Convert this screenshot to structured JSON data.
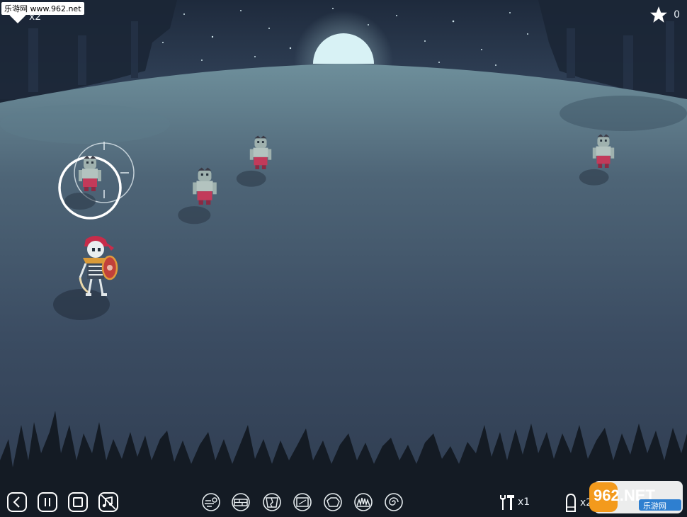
{
  "watermark_top": "乐游网 www.962.net",
  "hud": {
    "lives_label": "x2",
    "stars_label": "0"
  },
  "controls": {
    "icons": [
      "back-icon",
      "pause-icon",
      "stop-icon",
      "music-off-icon"
    ]
  },
  "abilities": {
    "icons": [
      "wind-icon",
      "barrier-icon",
      "crack-icon",
      "box-icon",
      "rock-icon",
      "spikes-icon",
      "vortex-icon"
    ]
  },
  "counters": {
    "tools_label": "x1",
    "ammo_label": "x2"
  },
  "logo": {
    "brand_text": "962.NET",
    "sub_text": "乐游网"
  },
  "colors": {
    "sky": "#27344b",
    "ground": "#3a4b62",
    "moon": "#d8f2f5",
    "grass": "#141b24",
    "enemy_pants": "#c23a5a",
    "hero_bandana": "#c72c4a"
  }
}
